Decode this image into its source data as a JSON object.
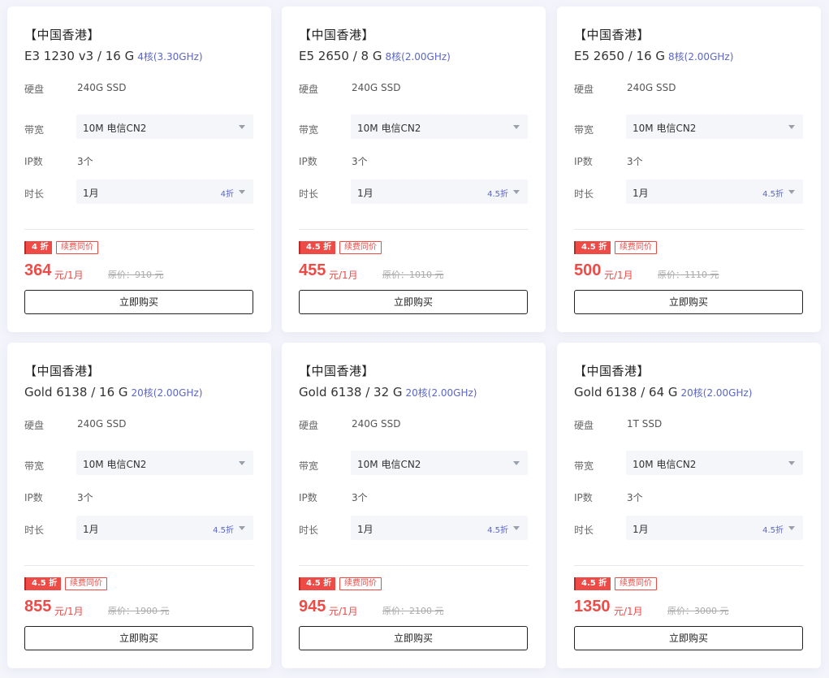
{
  "labels": {
    "disk": "硬盘",
    "bandwidth": "带宽",
    "ip": "IP数",
    "duration": "时长",
    "renew": "续费同价",
    "buy": "立即购买"
  },
  "colors": {
    "accent": "#ee4a46",
    "core_text": "#5b66c9",
    "background": "#f4f5fb"
  },
  "icons": {
    "select_arrow": "caret-down-icon"
  },
  "cards": [
    {
      "region": "【中国香港】",
      "model": "E3 1230 v3 / 16 G",
      "cores": "4核(3.30GHz)",
      "disk": "240G SSD",
      "bandwidth": "10M 电信CN2",
      "ip": "3个",
      "duration": "1月",
      "duration_discount": "4折",
      "discount_badge": "4 折",
      "price": "364",
      "unit": "元/1月",
      "original": "原价：910 元"
    },
    {
      "region": "【中国香港】",
      "model": "E5 2650 / 8 G",
      "cores": "8核(2.00GHz)",
      "disk": "240G SSD",
      "bandwidth": "10M 电信CN2",
      "ip": "3个",
      "duration": "1月",
      "duration_discount": "4.5折",
      "discount_badge": "4.5 折",
      "price": "455",
      "unit": "元/1月",
      "original": "原价：1010 元"
    },
    {
      "region": "【中国香港】",
      "model": "E5 2650 / 16 G",
      "cores": "8核(2.00GHz)",
      "disk": "240G SSD",
      "bandwidth": "10M 电信CN2",
      "ip": "3个",
      "duration": "1月",
      "duration_discount": "4.5折",
      "discount_badge": "4.5 折",
      "price": "500",
      "unit": "元/1月",
      "original": "原价：1110 元"
    },
    {
      "region": "【中国香港】",
      "model": "Gold 6138 / 16 G",
      "cores": "20核(2.00GHz)",
      "disk": "240G SSD",
      "bandwidth": "10M 电信CN2",
      "ip": "3个",
      "duration": "1月",
      "duration_discount": "4.5折",
      "discount_badge": "4.5 折",
      "price": "855",
      "unit": "元/1月",
      "original": "原价：1900 元"
    },
    {
      "region": "【中国香港】",
      "model": "Gold 6138 / 32 G",
      "cores": "20核(2.00GHz)",
      "disk": "240G SSD",
      "bandwidth": "10M 电信CN2",
      "ip": "3个",
      "duration": "1月",
      "duration_discount": "4.5折",
      "discount_badge": "4.5 折",
      "price": "945",
      "unit": "元/1月",
      "original": "原价：2100 元"
    },
    {
      "region": "【中国香港】",
      "model": "Gold 6138 / 64 G",
      "cores": "20核(2.00GHz)",
      "disk": "1T SSD",
      "bandwidth": "10M 电信CN2",
      "ip": "3个",
      "duration": "1月",
      "duration_discount": "4.5折",
      "discount_badge": "4.5 折",
      "price": "1350",
      "unit": "元/1月",
      "original": "原价：3000 元"
    }
  ]
}
